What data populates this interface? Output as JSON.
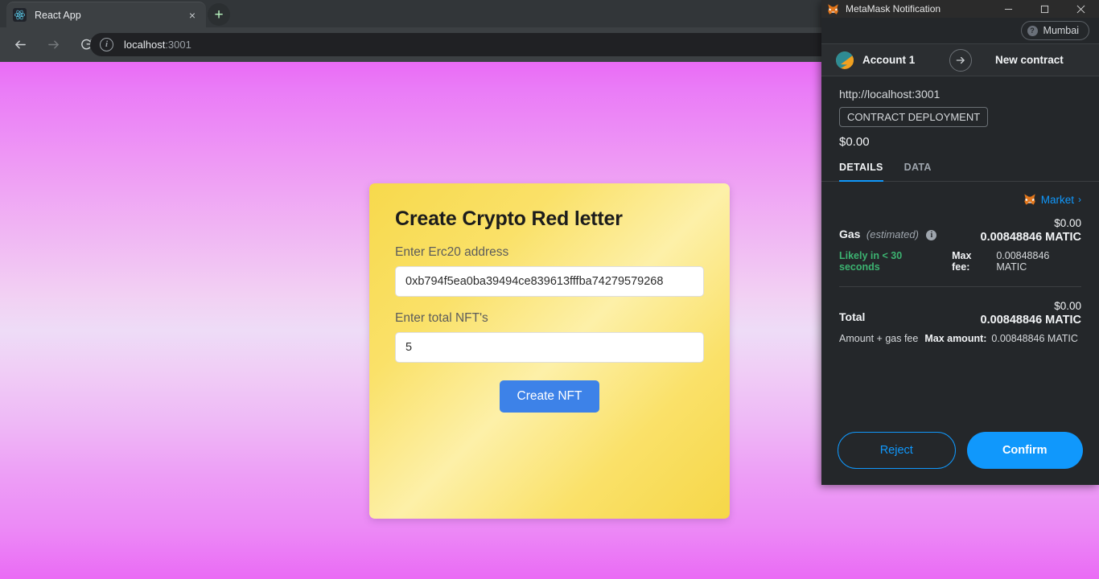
{
  "browser": {
    "tab": {
      "title": "React App",
      "favicon": "react-icon",
      "close_label": "×"
    },
    "new_tab_label": "+",
    "nav": {
      "back": "←",
      "forward": "→",
      "reload": "⟳"
    },
    "omnibox": {
      "info_icon": "info-icon",
      "host": "localhost",
      "port": ":3001",
      "full_url": "localhost:3001"
    }
  },
  "page": {
    "card": {
      "title": "Create Crypto Red letter",
      "fields": [
        {
          "label": "Enter Erc20 address",
          "value": "0xb794f5ea0ba39494ce839613fffba74279579268",
          "placeholder": "Enter Erc20 address"
        },
        {
          "label": "Enter total NFT's",
          "value": "5",
          "placeholder": "Enter total NFT's"
        }
      ],
      "submit_label": "Create NFT"
    },
    "colors": {
      "card_gradient_start": "#f7d94c",
      "card_gradient_mid": "#fdf0a8",
      "background_magenta": "#ea6bf5",
      "background_light": "#eedcf7",
      "button_blue": "#3d82e8"
    }
  },
  "metamask": {
    "window_title": "MetaMask Notification",
    "window_icon": "metamask-fox-icon",
    "window_controls": {
      "minimize": "minimize-icon",
      "maximize": "maximize-icon",
      "close": "close-icon"
    },
    "network": {
      "name": "Mumbai",
      "badge_glyph": "?"
    },
    "account": {
      "name": "Account 1",
      "avatar": "jazzicon-avatar",
      "arrow": "arrow-right-icon",
      "recipient": "New contract"
    },
    "origin": "http://localhost:3001",
    "transaction_tag": "CONTRACT DEPLOYMENT",
    "amount": "$0.00",
    "tabs": [
      {
        "label": "DETAILS",
        "active": true
      },
      {
        "label": "DATA",
        "active": false
      }
    ],
    "market": {
      "icon": "metamask-fox-icon",
      "label": "Market",
      "chevron": "›"
    },
    "gas": {
      "title": "Gas",
      "estimated_note": "(estimated)",
      "info_glyph": "i",
      "fiat": "$0.00",
      "native": "0.00848846 MATIC",
      "speed_text": "Likely in < 30 seconds",
      "max_fee_label": "Max fee:",
      "max_fee_value": "0.00848846 MATIC"
    },
    "total": {
      "title": "Total",
      "fiat": "$0.00",
      "native": "0.00848846 MATIC",
      "description": "Amount + gas fee",
      "max_amount_label": "Max amount:",
      "max_amount_value": "0.00848846 MATIC"
    },
    "footer": {
      "reject_label": "Reject",
      "confirm_label": "Confirm"
    },
    "colors": {
      "accent_blue": "#1098fc",
      "panel_bg": "#24272a",
      "success_green": "#3cb371"
    }
  }
}
